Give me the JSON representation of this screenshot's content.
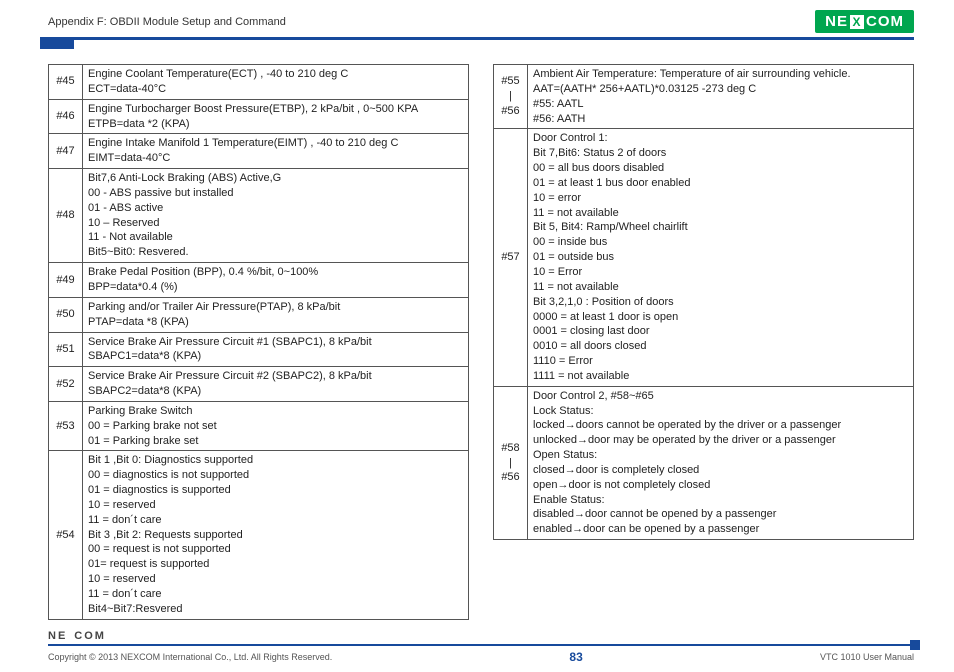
{
  "header": {
    "title": "Appendix F: OBDII Module Setup and Command"
  },
  "logo": {
    "text": "NEXCOM"
  },
  "left_table": [
    {
      "idx": "#45",
      "text": "Engine Coolant Temperature(ECT) , -40 to 210 deg C\nECT=data-40°C"
    },
    {
      "idx": "#46",
      "text": "Engine Turbocharger Boost Pressure(ETBP), 2 kPa/bit , 0~500 KPA\nETPB=data *2 (KPA)"
    },
    {
      "idx": "#47",
      "text": "Engine Intake Manifold 1 Temperature(EIMT) , -40 to 210 deg C\nEIMT=data-40°C"
    },
    {
      "idx": "#48",
      "text": "Bit7,6 Anti-Lock Braking (ABS) Active,G\n00 - ABS passive but installed\n01 - ABS active\n10 – Reserved\n11 - Not available\nBit5~Bit0: Resvered."
    },
    {
      "idx": "#49",
      "text": "Brake Pedal Position (BPP), 0.4 %/bit, 0~100%\nBPP=data*0.4 (%)"
    },
    {
      "idx": "#50",
      "text": "Parking and/or Trailer Air Pressure(PTAP), 8 kPa/bit\nPTAP=data *8 (KPA)"
    },
    {
      "idx": "#51",
      "text": "Service Brake Air Pressure Circuit #1 (SBAPC1), 8 kPa/bit\nSBAPC1=data*8 (KPA)"
    },
    {
      "idx": "#52",
      "text": "Service Brake Air Pressure Circuit #2 (SBAPC2), 8 kPa/bit\nSBAPC2=data*8 (KPA)"
    },
    {
      "idx": "#53",
      "text": "Parking Brake Switch\n00 = Parking brake not set\n01 = Parking brake set"
    },
    {
      "idx": "#54",
      "text": "Bit 1 ,Bit 0: Diagnostics supported\n00 = diagnostics is not supported\n01 = diagnostics is supported\n10 = reserved\n11 = don´t care\nBit 3 ,Bit 2: Requests supported\n00 = request is not supported\n01= request is supported\n10 = reserved\n11 = don´t care\nBit4~Bit7:Resvered"
    }
  ],
  "right_table": [
    {
      "idx": "#55\n|\n#56",
      "text": "Ambient Air Temperature: Temperature of air surrounding vehicle.\nAAT=(AATH* 256+AATL)*0.03125 -273 deg C\n#55: AATL\n#56: AATH"
    },
    {
      "idx": "#57",
      "text": "Door Control 1:\nBit 7,Bit6: Status 2 of doors\n00 = all bus doors disabled\n01 = at least 1 bus door enabled\n10 = error\n11 = not available\nBit 5, Bit4: Ramp/Wheel chairlift\n00 = inside bus\n01 = outside bus\n10 = Error\n11 = not available\nBit 3,2,1,0 : Position of doors\n0000 = at least 1 door is open\n0001 = closing last door\n0010 = all doors closed\n1110 = Error\n1111 = not available"
    },
    {
      "idx": "#58\n|\n#56",
      "text": "Door Control 2, #58~#65\nLock Status:\nlocked→doors cannot be operated by the driver or a passenger\nunlocked→door may be operated by the driver or a passenger\nOpen Status:\nclosed→door is completely closed\nopen→door is not completely closed\nEnable Status:\ndisabled→door cannot be opened by a passenger\nenabled→door can be opened by a passenger"
    }
  ],
  "footer": {
    "logo": "NE COM",
    "copyright": "Copyright © 2013 NEXCOM International Co., Ltd. All Rights Reserved.",
    "page": "83",
    "doc": "VTC 1010 User Manual"
  }
}
